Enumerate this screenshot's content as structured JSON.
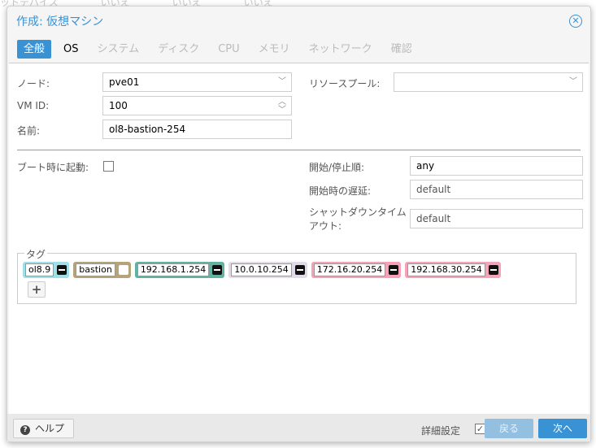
{
  "background_text": [
    "ットデバイス",
    "いいえ",
    "いいえ",
    "いいえ"
  ],
  "dialog": {
    "title": "作成: 仮想マシン",
    "close_icon": "close-circle-icon"
  },
  "tabs": [
    {
      "label": "全般",
      "state": "active"
    },
    {
      "label": "OS",
      "state": "enabled"
    },
    {
      "label": "システム",
      "state": "disabled"
    },
    {
      "label": "ディスク",
      "state": "disabled"
    },
    {
      "label": "CPU",
      "state": "disabled"
    },
    {
      "label": "メモリ",
      "state": "disabled"
    },
    {
      "label": "ネットワーク",
      "state": "disabled"
    },
    {
      "label": "確認",
      "state": "disabled"
    }
  ],
  "form": {
    "node_label": "ノード:",
    "node_value": "pve01",
    "vmid_label": "VM ID:",
    "vmid_value": "100",
    "name_label": "名前:",
    "name_value": "ol8-bastion-254",
    "pool_label": "リソースプール:",
    "pool_value": "",
    "onboot_label": "ブート時に起動:",
    "onboot_checked": false,
    "order_label": "開始/停止順:",
    "order_value": "any",
    "delay_label": "開始時の遅延:",
    "delay_value": "default",
    "shutdown_label": "シャットダウンタイムアウト:",
    "shutdown_value": "default"
  },
  "tags": {
    "legend": "タグ",
    "items": [
      {
        "value": "ol8.9",
        "color": "#9fdfe8"
      },
      {
        "value": "bastion",
        "color": "#b5a37a"
      },
      {
        "value": "192.168.1.254",
        "color": "#62b2a4"
      },
      {
        "value": "10.0.10.254",
        "color": "#e2dae8"
      },
      {
        "value": "172.16.20.254",
        "color": "#f6a1b5"
      },
      {
        "value": "192.168.30.254",
        "color": "#f4a3b9"
      }
    ]
  },
  "footer": {
    "help": "ヘルプ",
    "advanced": "詳細設定",
    "advanced_checked": true,
    "back": "戻る",
    "next": "次へ"
  },
  "colors": {
    "accent": "#3892d4",
    "disabled_button": "#93bfe0"
  }
}
